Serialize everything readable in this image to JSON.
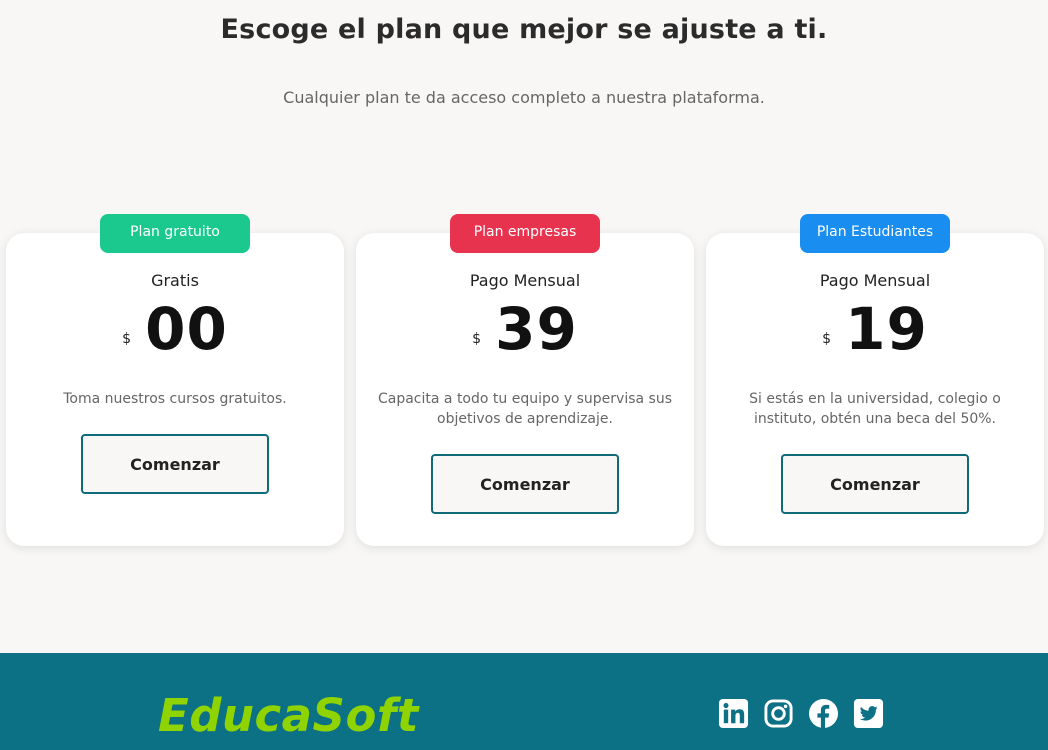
{
  "hero": {
    "title": "Escoge el plan que mejor se ajuste a ti.",
    "subtitle": "Cualquier plan te da acceso completo a nuestra plataforma."
  },
  "plans": [
    {
      "badge": "Plan gratuito",
      "badge_color": "#1bc98e",
      "label": "Gratis",
      "currency": "$",
      "amount": "00",
      "description": "Toma nuestros cursos gratuitos.",
      "cta": "Comenzar"
    },
    {
      "badge": "Plan empresas",
      "badge_color": "#e8334f",
      "label": "Pago Mensual",
      "currency": "$",
      "amount": "39",
      "description": "Capacita a todo tu equipo y supervisa sus objetivos de aprendizaje.",
      "cta": "Comenzar"
    },
    {
      "badge": "Plan Estudiantes",
      "badge_color": "#1a8df0",
      "label": "Pago Mensual",
      "currency": "$",
      "amount": "19",
      "description": "Si estás en la universidad, colegio o instituto, obtén una beca del 50%.",
      "cta": "Comenzar"
    }
  ],
  "footer": {
    "brand": "EducaSoft",
    "brand_color": "#8fd400",
    "background": "#0d7185",
    "social": [
      {
        "icon": "linkedin-icon"
      },
      {
        "icon": "instagram-icon"
      },
      {
        "icon": "facebook-icon"
      },
      {
        "icon": "twitter-icon"
      }
    ]
  }
}
